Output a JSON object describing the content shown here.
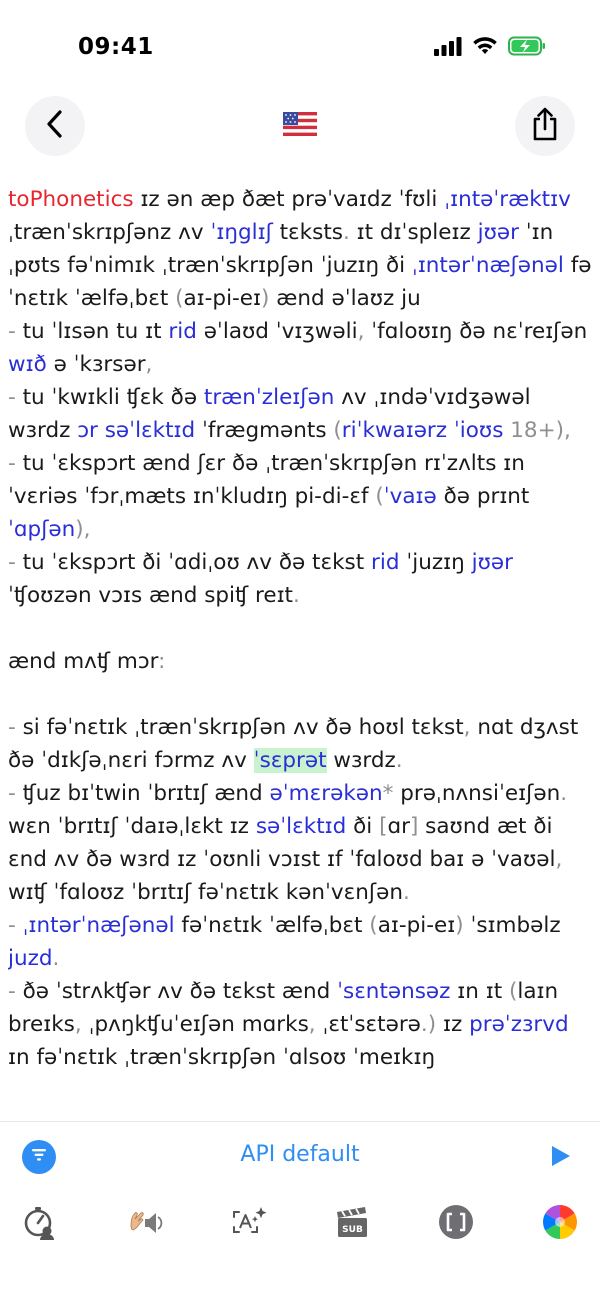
{
  "status_bar": {
    "time": "09:41"
  },
  "nav": {
    "back_icon": "chevron-left-icon",
    "flag_icon": "us-flag-icon",
    "share_icon": "share-icon"
  },
  "colors": {
    "red": "#e8262f",
    "blue": "#2a2ed6",
    "gray": "#8e8e93",
    "green_highlight": "#c9f2cf",
    "accent": "#2f8ef4"
  },
  "content": {
    "paragraphs": [
      [
        {
          "t": "toPhonetics",
          "c": "red"
        },
        {
          "t": " ɪz ən æp ðæt prəˈvaɪdz ˈfʊli "
        },
        {
          "t": "ˌɪntəˈræktɪv",
          "c": "blue"
        },
        {
          "t": " ˌtrænˈskrɪpʃənz ʌv "
        },
        {
          "t": "ˈɪŋglɪʃ",
          "c": "blue"
        },
        {
          "t": " tɛksts"
        },
        {
          "t": ".",
          "c": "gray"
        },
        {
          "t": " ɪt dɪˈspleɪz "
        },
        {
          "t": "jʊər",
          "c": "blue"
        },
        {
          "t": " ˈɪnˌpʊts fəˈnimɪk ˌtrænˈskrɪpʃən ˈjuzɪŋ ði "
        },
        {
          "t": "ˌɪntərˈnæʃənəl",
          "c": "blue"
        },
        {
          "t": " fəˈnɛtɪk ˈælfəˌbɛt "
        },
        {
          "t": "(",
          "c": "gray"
        },
        {
          "t": "aɪ-pi-eɪ"
        },
        {
          "t": ")",
          "c": "gray"
        },
        {
          "t": " ænd əˈlaʊz ju"
        }
      ],
      [
        {
          "t": "-",
          "c": "gray"
        },
        {
          "t": " tu ˈlɪsən tu ɪt "
        },
        {
          "t": "rid",
          "c": "blue"
        },
        {
          "t": " əˈlaʊd ˈvɪʒwəli"
        },
        {
          "t": ",",
          "c": "gray"
        },
        {
          "t": " ˈfɑloʊɪŋ ðə nɛˈreɪʃən "
        },
        {
          "t": "wɪð",
          "c": "blue"
        },
        {
          "t": " ə ˈkɜrsər"
        },
        {
          "t": ",",
          "c": "gray"
        }
      ],
      [
        {
          "t": "-",
          "c": "gray"
        },
        {
          "t": " tu ˈkwɪkli ʧɛk ðə "
        },
        {
          "t": "trænˈzleɪʃən",
          "c": "blue"
        },
        {
          "t": " ʌv ˌɪndəˈvɪdʒəwəl wɜrdz "
        },
        {
          "t": "ɔr səˈlɛktɪd",
          "c": "blue"
        },
        {
          "t": " ˈfrægmənts "
        },
        {
          "t": "(",
          "c": "gray"
        },
        {
          "t": "riˈkwaɪərz ˈioʊs",
          "c": "blue"
        },
        {
          "t": " 18+),",
          "c": "gray"
        }
      ],
      [
        {
          "t": "-",
          "c": "gray"
        },
        {
          "t": " tu ˈɛkspɔrt ænd ʃɛr ðə ˌtrænˈskrɪpʃən rɪˈzʌlts ɪn ˈvɛriəs ˈfɔrˌmæts ɪnˈkludɪŋ pi-di-ɛf "
        },
        {
          "t": "(",
          "c": "gray"
        },
        {
          "t": "ˈvaɪə",
          "c": "blue"
        },
        {
          "t": " ðə prɪnt "
        },
        {
          "t": "ˈɑpʃən",
          "c": "blue"
        },
        {
          "t": "),",
          "c": "gray"
        }
      ],
      [
        {
          "t": "-",
          "c": "gray"
        },
        {
          "t": " tu ˈɛkspɔrt ði ˈɑdiˌoʊ ʌv ðə tɛkst "
        },
        {
          "t": "rid",
          "c": "blue"
        },
        {
          "t": " ˈjuzɪŋ "
        },
        {
          "t": "jʊər",
          "c": "blue"
        },
        {
          "t": " ˈʧoʊzən vɔɪs ænd spiʧ reɪt"
        },
        {
          "t": ".",
          "c": "gray"
        }
      ],
      [
        {
          "t": " "
        }
      ],
      [
        {
          "t": "ænd mʌʧ mɔr"
        },
        {
          "t": ":",
          "c": "gray"
        }
      ],
      [
        {
          "t": " "
        }
      ],
      [
        {
          "t": "-",
          "c": "gray"
        },
        {
          "t": " si fəˈnɛtɪk ˌtrænˈskrɪpʃən ʌv ðə hoʊl tɛkst"
        },
        {
          "t": ",",
          "c": "gray"
        },
        {
          "t": " nɑt dʒʌst ðə ˈdɪkʃəˌnɛri fɔrmz ʌv "
        },
        {
          "t": "ˈsɛprət",
          "c": "green"
        },
        {
          "t": " wɜrdz"
        },
        {
          "t": ".",
          "c": "gray"
        }
      ],
      [
        {
          "t": "-",
          "c": "gray"
        },
        {
          "t": " ʧuz bɪˈtwin ˈbrɪtɪʃ ænd "
        },
        {
          "t": "əˈmɛrəkən",
          "c": "blue"
        },
        {
          "t": "*",
          "c": "gray"
        },
        {
          "t": " prəˌnʌnsiˈeɪʃən"
        },
        {
          "t": ".",
          "c": "gray"
        },
        {
          "t": " wɛn ˈbrɪtɪʃ ˈdaɪəˌlɛkt ɪz "
        },
        {
          "t": "səˈlɛktɪd",
          "c": "blue"
        },
        {
          "t": " ði "
        },
        {
          "t": "[",
          "c": "gray"
        },
        {
          "t": "ɑr"
        },
        {
          "t": "]",
          "c": "gray"
        },
        {
          "t": " saʊnd æt ði ɛnd ʌv ðə wɜrd ɪz ˈoʊnli vɔɪst ɪf ˈfɑloʊd baɪ ə ˈvaʊəl"
        },
        {
          "t": ",",
          "c": "gray"
        },
        {
          "t": " wɪʧ ˈfɑloʊz ˈbrɪtɪʃ fəˈnɛtɪk kənˈvɛnʃən"
        },
        {
          "t": ".",
          "c": "gray"
        }
      ],
      [
        {
          "t": "-",
          "c": "gray"
        },
        {
          "t": " "
        },
        {
          "t": "ˌɪntərˈnæʃənəl",
          "c": "blue"
        },
        {
          "t": " fəˈnɛtɪk ˈælfəˌbɛt "
        },
        {
          "t": "(",
          "c": "gray"
        },
        {
          "t": "aɪ-pi-eɪ"
        },
        {
          "t": ")",
          "c": "gray"
        },
        {
          "t": " ˈsɪmbəlz "
        },
        {
          "t": "juzd",
          "c": "blue"
        },
        {
          "t": ".",
          "c": "gray"
        }
      ],
      [
        {
          "t": "-",
          "c": "gray"
        },
        {
          "t": " ðə ˈstrʌkʧər ʌv ðə tɛkst ænd "
        },
        {
          "t": "ˈsɛntənsəz",
          "c": "blue"
        },
        {
          "t": " ɪn ɪt "
        },
        {
          "t": "(",
          "c": "gray"
        },
        {
          "t": "laɪn breɪks"
        },
        {
          "t": ",",
          "c": "gray"
        },
        {
          "t": " ˌpʌŋkʧuˈeɪʃən mɑrks"
        },
        {
          "t": ",",
          "c": "gray"
        },
        {
          "t": " ˌɛtˈsɛtərə"
        },
        {
          "t": ".)",
          "c": "gray"
        },
        {
          "t": " ɪz "
        },
        {
          "t": "prəˈzɜrvd",
          "c": "blue"
        },
        {
          "t": " ɪn fəˈnɛtɪk ˌtrænˈskrɪpʃən ˈɑlsoʊ ˈmeɪkɪŋ"
        }
      ]
    ]
  },
  "toolbar": {
    "api_label": "API default",
    "filter_icon": "filter-icon",
    "play_icon": "play-icon",
    "icons": [
      "speed-timer-icon",
      "voice-speaker-icon",
      "ai-text-icon",
      "subtitles-icon",
      "brackets-icon",
      "color-wheel-icon"
    ]
  }
}
